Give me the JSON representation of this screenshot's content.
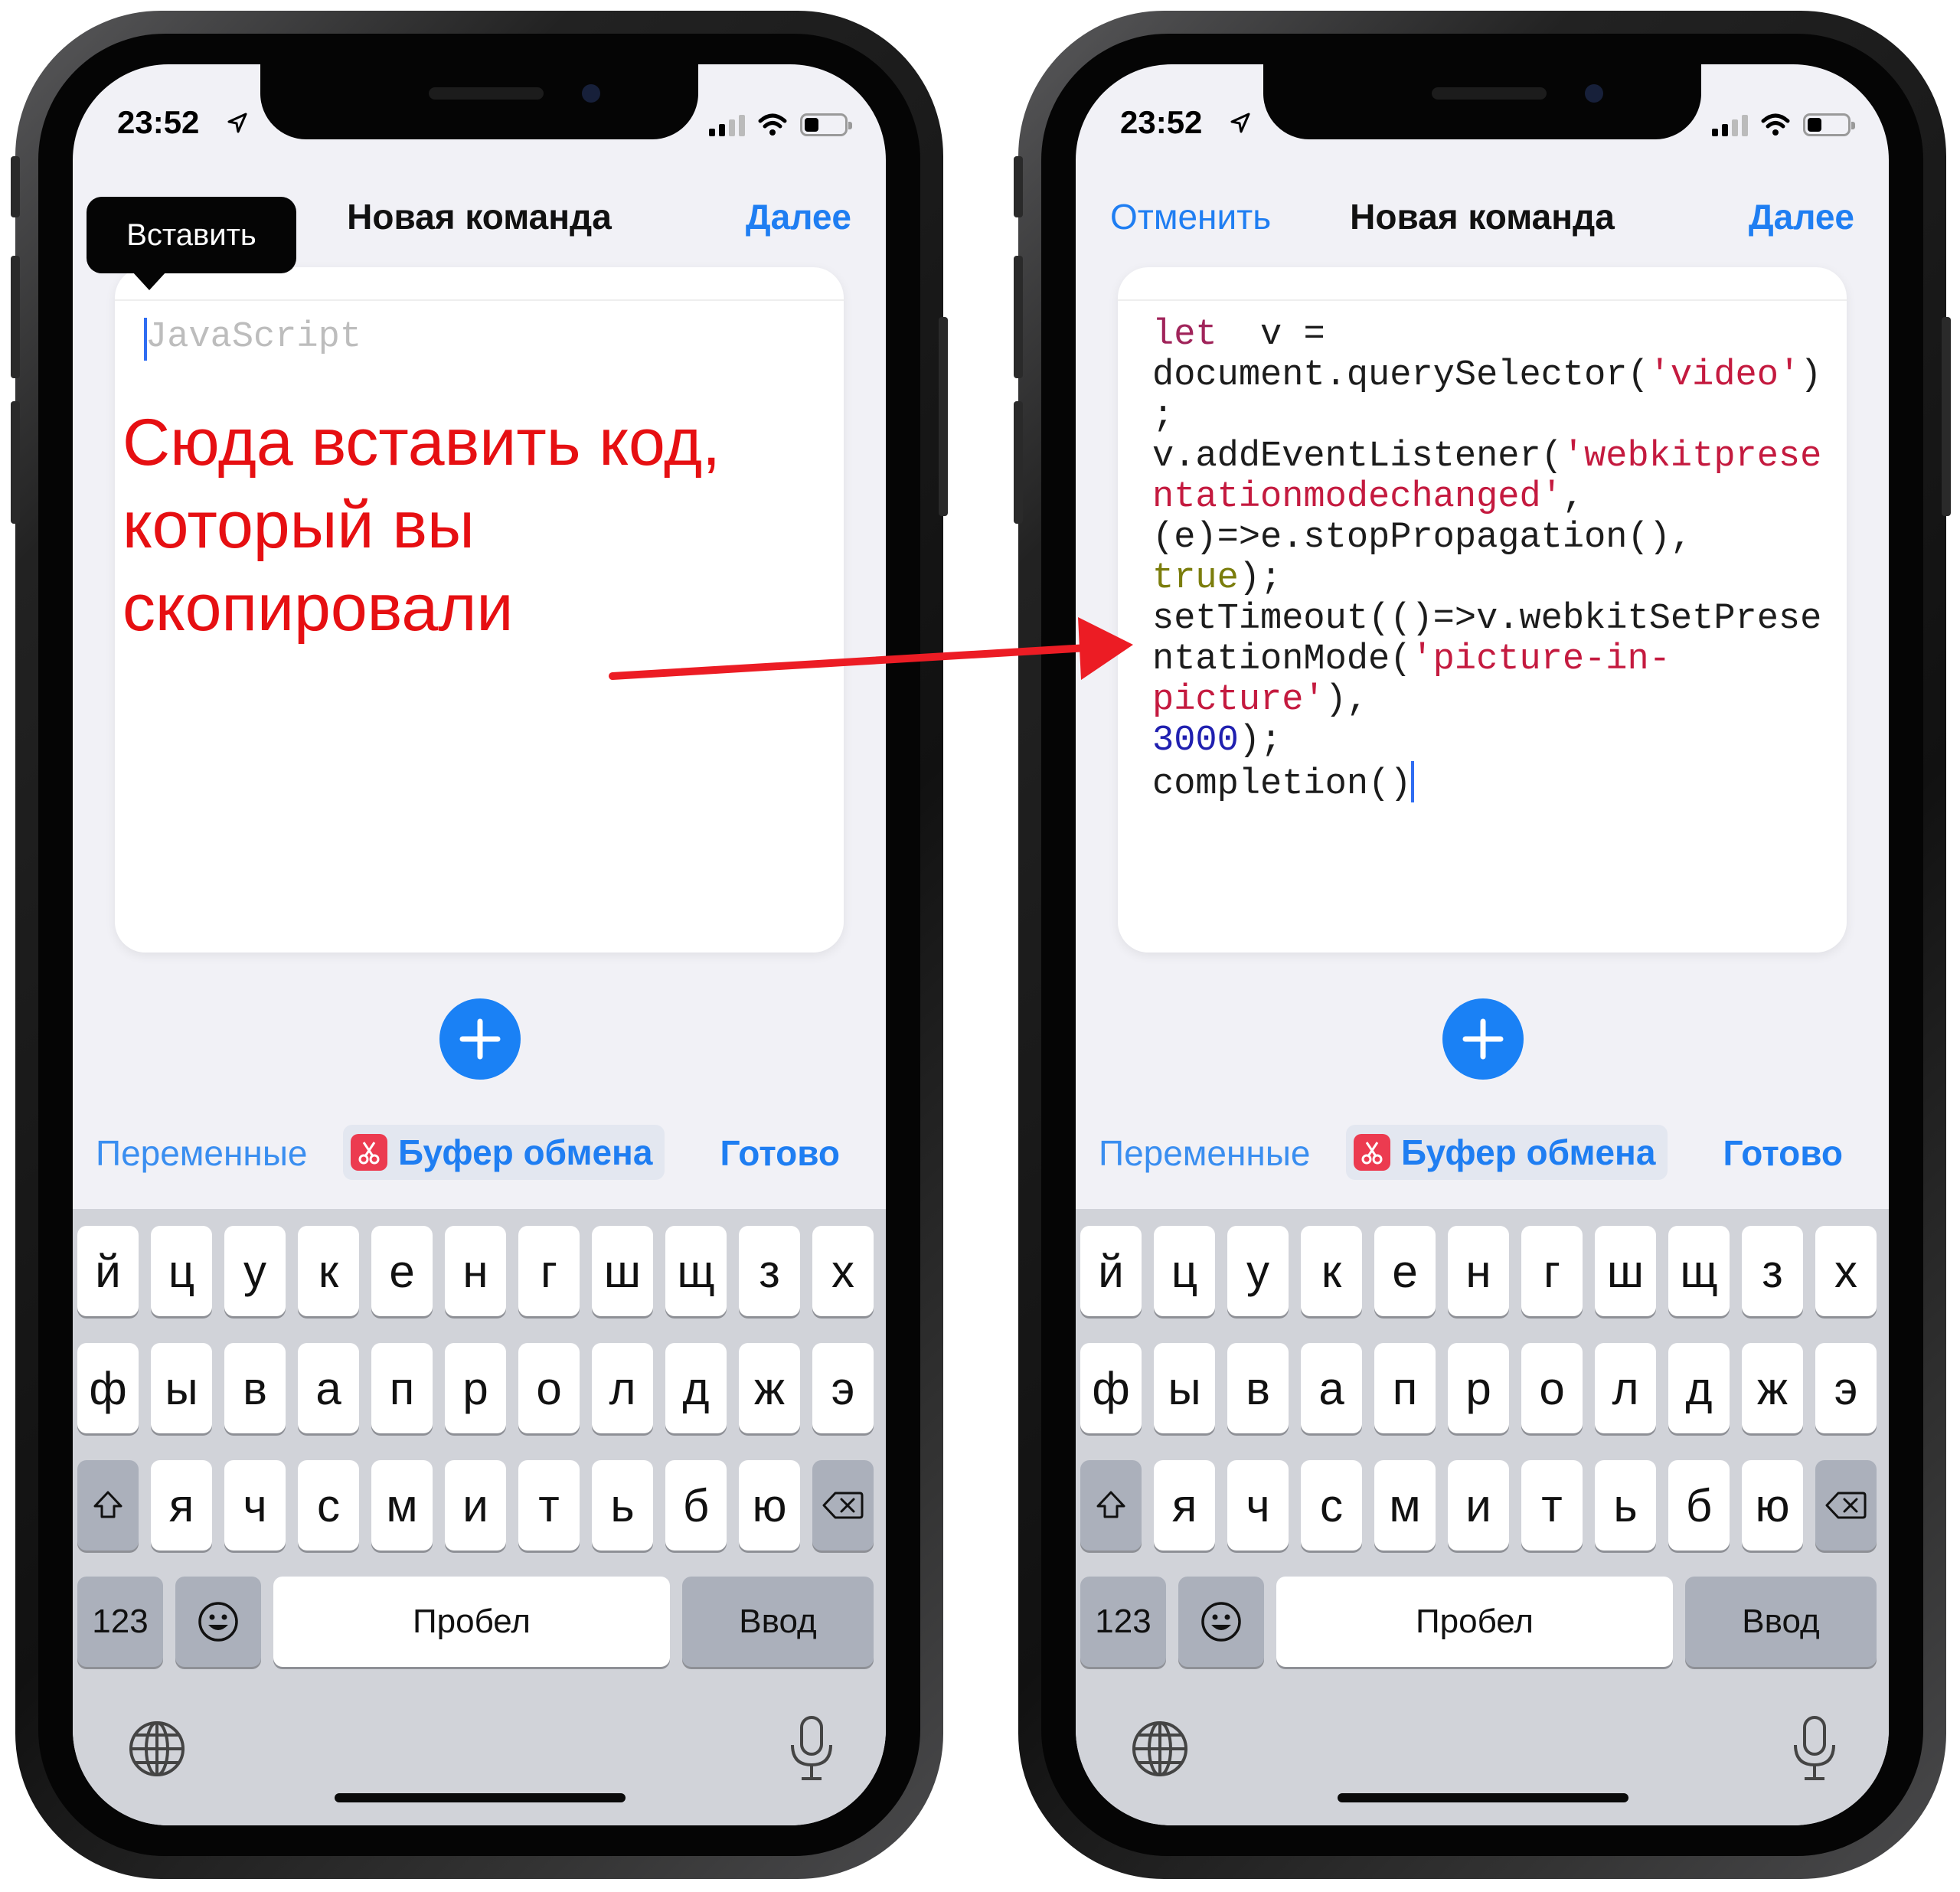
{
  "phones": [
    {
      "status": {
        "time": "23:52"
      },
      "nav": {
        "left": "",
        "title": "Новая команда",
        "right": "Далее"
      },
      "popup": "Вставить",
      "editor": {
        "placeholder": "JavaScript"
      },
      "annotation": [
        "Сюда вставить код,",
        "который вы",
        "скопировали"
      ]
    },
    {
      "status": {
        "time": "23:52"
      },
      "nav": {
        "left": "Отменить",
        "title": "Новая команда",
        "right": "Далее"
      },
      "editor": {
        "code_lines": [
          [
            [
              "kw",
              "let"
            ],
            [
              "",
              "  v ="
            ]
          ],
          [
            [
              "",
              "document.querySelector("
            ],
            [
              "str",
              "'video'"
            ],
            [
              "",
              ")"
            ]
          ],
          [
            [
              "",
              ";"
            ]
          ],
          [
            [
              "",
              "v.addEventListener("
            ],
            [
              "str",
              "'webkitprese"
            ]
          ],
          [
            [
              "str",
              "ntationmodechanged'"
            ],
            [
              "",
              ","
            ]
          ],
          [
            [
              "",
              "(e)=>e.stopPropagation(),"
            ]
          ],
          [
            [
              "bool",
              "true"
            ],
            [
              "",
              ");"
            ]
          ],
          [
            [
              "",
              "setTimeout(()=>v.webkitSetPrese"
            ]
          ],
          [
            [
              "",
              "ntationMode("
            ],
            [
              "str",
              "'picture-in-"
            ]
          ],
          [
            [
              "str",
              "picture'"
            ],
            [
              "",
              "),"
            ]
          ],
          [
            [
              "num",
              "3000"
            ],
            [
              "",
              ");"
            ]
          ],
          [
            [
              "",
              "completion()"
            ]
          ]
        ]
      }
    }
  ],
  "toolbar": {
    "variables": "Переменные",
    "clipboard": "Буфер обмена",
    "done": "Готово"
  },
  "keyboard": {
    "row1": [
      "й",
      "ц",
      "у",
      "к",
      "е",
      "н",
      "г",
      "ш",
      "щ",
      "з",
      "х"
    ],
    "row2": [
      "ф",
      "ы",
      "в",
      "а",
      "п",
      "р",
      "о",
      "л",
      "д",
      "ж",
      "э"
    ],
    "row3": [
      "я",
      "ч",
      "с",
      "м",
      "и",
      "т",
      "ь",
      "б",
      "ю"
    ],
    "numbers": "123",
    "space": "Пробел",
    "return": "Ввод"
  },
  "icons": [
    "location-arrow-icon",
    "cellular-signal-icon",
    "wifi-icon",
    "battery-icon",
    "plus-icon",
    "clipboard-scissors-icon",
    "shift-icon",
    "backspace-icon",
    "emoji-icon",
    "globe-icon",
    "microphone-icon"
  ],
  "colors": {
    "accent": "#1f7ef2",
    "annotation_red": "#e60f12",
    "arrow_red": "#ec1c24",
    "plus_button": "#1a81f5",
    "clipboard_icon": "#ec3b50"
  }
}
